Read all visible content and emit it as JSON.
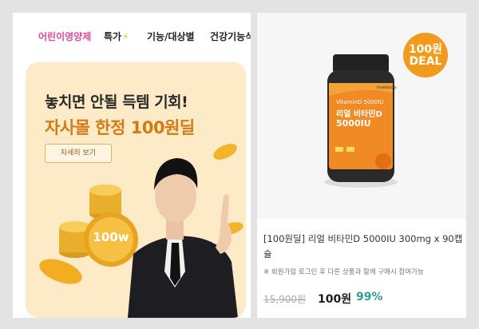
{
  "nav": {
    "tabs": [
      {
        "label": "어린이영양제",
        "active": true
      },
      {
        "label": "특가",
        "icon": "lightning-icon"
      },
      {
        "label": "기능/대상별"
      },
      {
        "label": "건강기능식"
      }
    ]
  },
  "banner": {
    "title": "놓치면 안될 득템 기회!",
    "subtitle": "자사몰 한정 100원딜",
    "detail_button": "자세히 보기",
    "coin_label": "100w"
  },
  "product": {
    "badge": {
      "line1": "100원",
      "line2": "DEAL"
    },
    "bottle": {
      "vitamin_label": "VitaminD 5000IU",
      "name_line1": "리얼 비타민D",
      "name_line2": "5000IU",
      "brand": "foodology"
    },
    "name": "[100원딜] 리얼 비타민D 5000IU 300mg x 90캡슐",
    "note": "※ 회원가입 로그인 후 다른 상품과 함께 구매시 참여가능",
    "original_price": "15,900원",
    "sale_price": "100원",
    "discount": "99%"
  },
  "colors": {
    "accent_pink": "#e0499a",
    "banner_bg": "#fdebc8",
    "highlight_orange": "#d37a14",
    "deal_orange": "#f29a1c",
    "discount_teal": "#2f9e8e"
  }
}
